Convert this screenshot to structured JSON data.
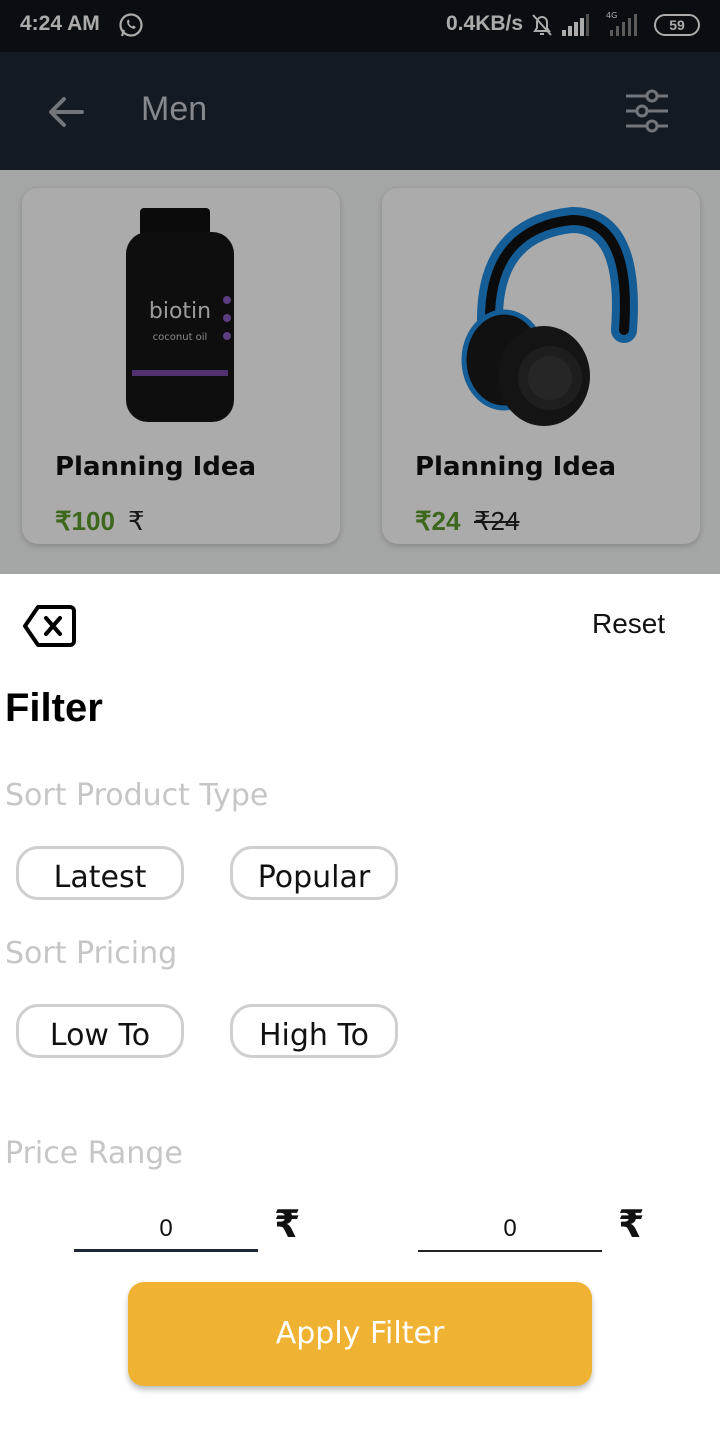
{
  "status_bar": {
    "time": "4:24 AM",
    "speed": "0.4KB/s",
    "network_label": "4G",
    "battery": "59",
    "icons": [
      "whatsapp-icon",
      "muted-bell-icon",
      "signal-icon",
      "signal-4g-icon",
      "battery-icon"
    ]
  },
  "app_bar": {
    "title": "Men",
    "back_icon": "arrow-left-icon",
    "filter_icon": "sliders-icon",
    "background": "#1e2733"
  },
  "products": [
    {
      "name": "Planning Idea",
      "price": "₹100",
      "old_price": "₹",
      "image": "biotin-bottle",
      "image_text": "biotin",
      "image_subtext": "coconut oil"
    },
    {
      "name": "Planning Idea",
      "price": "₹24",
      "old_price": "₹24",
      "image": "headphones"
    }
  ],
  "filter": {
    "close_icon": "backspace-close-icon",
    "reset_label": "Reset",
    "title": "Filter",
    "sort_type_label": "Sort Product Type",
    "sort_type_options": [
      "Latest",
      "Popular"
    ],
    "sort_pricing_label": "Sort Pricing",
    "sort_pricing_options": [
      "Low To",
      "High To"
    ],
    "price_range_label": "Price Range",
    "price_min": "0",
    "price_max": "0",
    "currency": "₹",
    "apply_label": "Apply Filter",
    "accent": "#f0b232",
    "price_color": "#5a9a2a"
  }
}
